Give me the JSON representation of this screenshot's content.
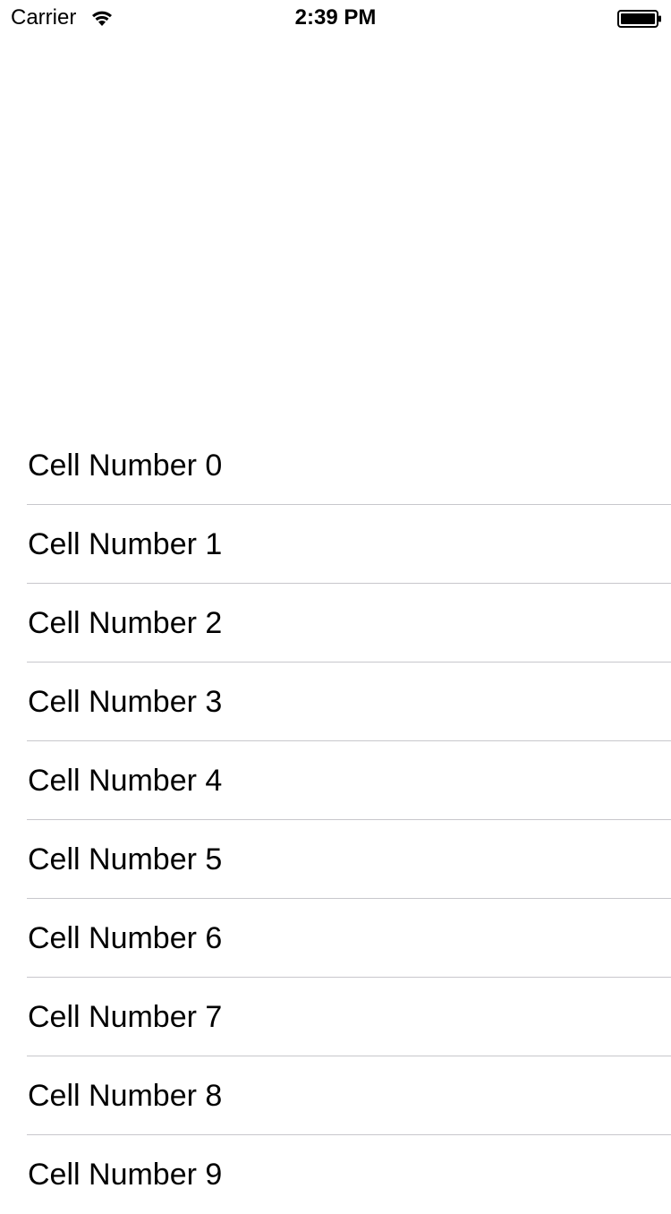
{
  "status_bar": {
    "carrier": "Carrier",
    "time": "2:39 PM",
    "wifi_icon": "wifi-icon",
    "battery_icon": "battery-icon"
  },
  "table": {
    "cells": [
      {
        "label": "Cell Number 0"
      },
      {
        "label": "Cell Number 1"
      },
      {
        "label": "Cell Number 2"
      },
      {
        "label": "Cell Number 3"
      },
      {
        "label": "Cell Number 4"
      },
      {
        "label": "Cell Number 5"
      },
      {
        "label": "Cell Number 6"
      },
      {
        "label": "Cell Number 7"
      },
      {
        "label": "Cell Number 8"
      },
      {
        "label": "Cell Number 9"
      }
    ]
  },
  "colors": {
    "background": "#ffffff",
    "text": "#000000",
    "separator": "#c8c7cc"
  }
}
